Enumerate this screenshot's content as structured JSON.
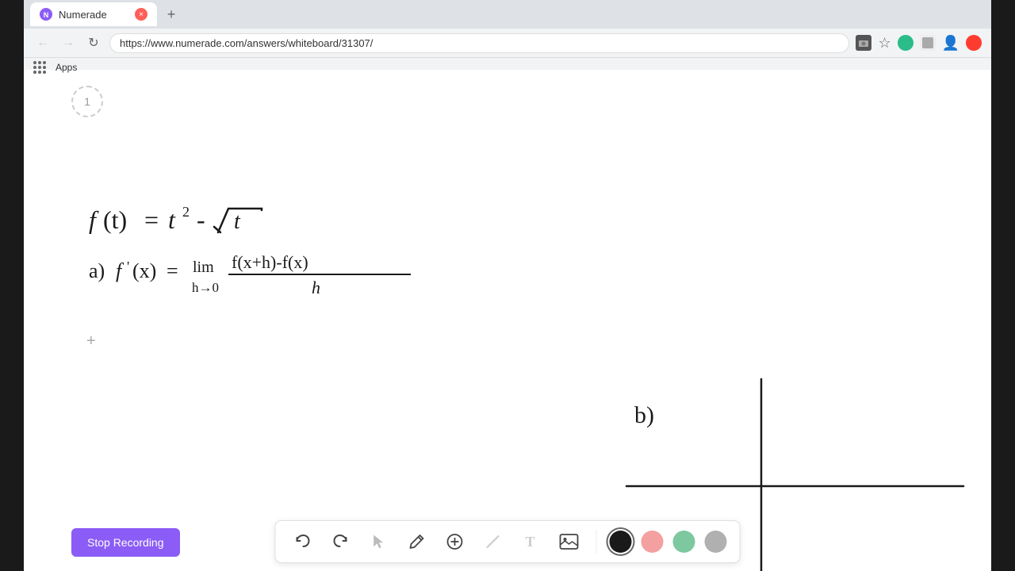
{
  "browser": {
    "tab_title": "Numerade",
    "tab_favicon_text": "N",
    "url": "https://www.numerade.com/answers/whiteboard/31307/",
    "new_tab_label": "+",
    "nav_back": "←",
    "nav_forward": "→",
    "nav_refresh": "↻",
    "bookmarks_apps": "Apps"
  },
  "toolbar": {
    "undo_label": "↺",
    "redo_label": "↻",
    "select_label": "▲",
    "pen_label": "✏",
    "add_label": "+",
    "eraser_label": "/",
    "text_label": "T",
    "image_label": "🖼",
    "colors": [
      {
        "name": "black",
        "hex": "#1a1a1a",
        "selected": true
      },
      {
        "name": "pink",
        "hex": "#f4a0a0",
        "selected": false
      },
      {
        "name": "green",
        "hex": "#7ec8a0",
        "selected": false
      },
      {
        "name": "gray",
        "hex": "#b0b0b0",
        "selected": false
      }
    ]
  },
  "recording": {
    "button_label": "Stop Recording"
  },
  "canvas": {
    "page_number": "1",
    "plus_icon": "+"
  }
}
